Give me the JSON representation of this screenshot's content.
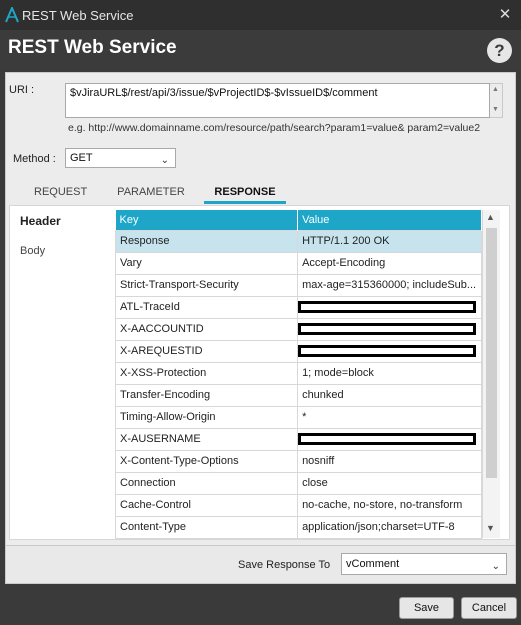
{
  "window": {
    "title": "REST Web Service",
    "close_glyph": "✕"
  },
  "header": {
    "heading": "REST Web Service",
    "help_glyph": "?"
  },
  "form": {
    "uri_label": "URI :",
    "uri_value": "$vJiraURL$/rest/api/3/issue/$vProjectID$-$vIssueID$/comment",
    "uri_example": "e.g. http://www.domainname.com/resource/path/search?param1=value& param2=value2",
    "method_label": "Method :",
    "method_value": "GET"
  },
  "tabs": [
    "REQUEST",
    "PARAMETER",
    "RESPONSE"
  ],
  "active_tab": "RESPONSE",
  "side": {
    "header": "Header",
    "body": "Body"
  },
  "table": {
    "columns": [
      "Key",
      "Value"
    ],
    "rows": [
      {
        "key": "Response",
        "value": "HTTP/1.1 200 OK",
        "redacted": false
      },
      {
        "key": "Vary",
        "value": "Accept-Encoding",
        "redacted": false
      },
      {
        "key": "Strict-Transport-Security",
        "value": "max-age=315360000; includeSub...",
        "redacted": false
      },
      {
        "key": "ATL-TraceId",
        "value": "",
        "redacted": true
      },
      {
        "key": "X-AACCOUNTID",
        "value": "",
        "redacted": true
      },
      {
        "key": "X-AREQUESTID",
        "value": "",
        "redacted": true
      },
      {
        "key": "X-XSS-Protection",
        "value": "1; mode=block",
        "redacted": false
      },
      {
        "key": "Transfer-Encoding",
        "value": "chunked",
        "redacted": false
      },
      {
        "key": "Timing-Allow-Origin",
        "value": "*",
        "redacted": false
      },
      {
        "key": "X-AUSERNAME",
        "value": "",
        "redacted": true
      },
      {
        "key": "X-Content-Type-Options",
        "value": "nosniff",
        "redacted": false
      },
      {
        "key": "Connection",
        "value": "close",
        "redacted": false
      },
      {
        "key": "Cache-Control",
        "value": "no-cache, no-store, no-transform",
        "redacted": false
      },
      {
        "key": "Content-Type",
        "value": "application/json;charset=UTF-8",
        "redacted": false
      }
    ]
  },
  "save_response": {
    "label": "Save Response To",
    "value": "vComment"
  },
  "buttons": {
    "save": "Save",
    "cancel": "Cancel"
  },
  "colors": {
    "accent": "#1ea6c9",
    "selected_row": "#c7e4ee",
    "dark_bg": "#3a3a3a"
  },
  "icons": {
    "logo": "app-logo-icon",
    "close": "close-icon",
    "help": "help-icon",
    "chevron": "chevron-down-icon"
  }
}
